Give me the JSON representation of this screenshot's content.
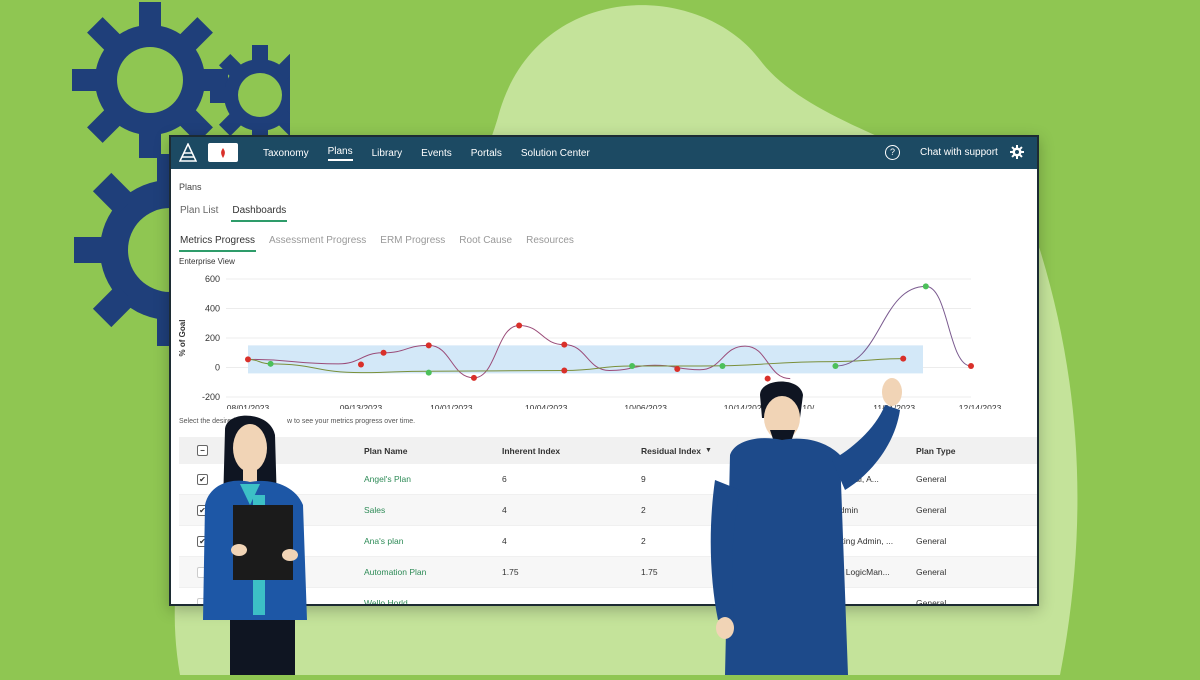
{
  "colors": {
    "background": "#8fc652",
    "topbar": "#1c4a63",
    "accent_green": "#2e9c6a",
    "gear": "#1f3f7a",
    "band": "#cfe6f7"
  },
  "topbar": {
    "nav": [
      {
        "label": "Taxonomy",
        "active": false
      },
      {
        "label": "Plans",
        "active": true
      },
      {
        "label": "Library",
        "active": false
      },
      {
        "label": "Events",
        "active": false
      },
      {
        "label": "Portals",
        "active": false
      },
      {
        "label": "Solution Center",
        "active": false
      }
    ],
    "help_icon": "?",
    "chat_label": "Chat with support",
    "settings_icon": "gear-icon"
  },
  "breadcrumb": "Plans",
  "tabs": [
    {
      "label": "Plan List",
      "active": false
    },
    {
      "label": "Dashboards",
      "active": true
    }
  ],
  "subtabs": [
    {
      "label": "Metrics Progress",
      "active": true
    },
    {
      "label": "Assessment Progress",
      "active": false
    },
    {
      "label": "ERM Progress",
      "active": false
    },
    {
      "label": "Root Cause",
      "active": false
    },
    {
      "label": "Resources",
      "active": false
    }
  ],
  "view_label": "Enterprise View",
  "chart_data": {
    "type": "line",
    "ylabel": "% of Goal",
    "ylim": [
      -200,
      600
    ],
    "yticks": [
      "600",
      "400",
      "200",
      "0",
      "-200"
    ],
    "xtick_labels": [
      "08/01/2023",
      "09/13/2023",
      "10/01/2023",
      "10/04/2023",
      "10/06/2023",
      "10/14/2023",
      "10/",
      "11/01/2023",
      "12/14/2023"
    ],
    "band": [
      -40,
      150
    ],
    "series": [
      {
        "color": "#9a4b78",
        "points": [
          [
            0,
            55
          ],
          [
            2,
            25
          ],
          [
            3,
            100
          ],
          [
            4,
            150
          ],
          [
            5,
            -70
          ],
          [
            6,
            285
          ],
          [
            7,
            155
          ],
          [
            8,
            -20
          ],
          [
            9,
            15
          ],
          [
            10,
            -15
          ],
          [
            11,
            145
          ],
          [
            12,
            -75
          ]
        ]
      },
      {
        "color": "#7a8f3a",
        "points": [
          [
            0,
            55
          ],
          [
            0.5,
            25
          ],
          [
            2.5,
            -35
          ],
          [
            4,
            -25
          ],
          [
            7,
            -20
          ],
          [
            8.5,
            10
          ],
          [
            10,
            10
          ],
          [
            13,
            40
          ],
          [
            14.5,
            60
          ]
        ]
      },
      {
        "color": "#7a5a8f",
        "points": [
          [
            13,
            10
          ],
          [
            15,
            550
          ],
          [
            16,
            10
          ]
        ]
      }
    ],
    "markers": [
      {
        "x": 0,
        "y": 55,
        "color": "#d9302a"
      },
      {
        "x": 0.5,
        "y": 25,
        "color": "#4cc05a"
      },
      {
        "x": 2.5,
        "y": 20,
        "color": "#d9302a"
      },
      {
        "x": 3,
        "y": 100,
        "color": "#d9302a"
      },
      {
        "x": 4,
        "y": 150,
        "color": "#d9302a"
      },
      {
        "x": 4,
        "y": -35,
        "color": "#4cc05a"
      },
      {
        "x": 5,
        "y": -70,
        "color": "#d9302a"
      },
      {
        "x": 6,
        "y": 285,
        "color": "#d9302a"
      },
      {
        "x": 7,
        "y": 155,
        "color": "#d9302a"
      },
      {
        "x": 7,
        "y": -20,
        "color": "#d9302a"
      },
      {
        "x": 8.5,
        "y": 10,
        "color": "#4cc05a"
      },
      {
        "x": 9.5,
        "y": -10,
        "color": "#d9302a"
      },
      {
        "x": 10.5,
        "y": 10,
        "color": "#4cc05a"
      },
      {
        "x": 11.5,
        "y": -75,
        "color": "#d9302a"
      },
      {
        "x": 13,
        "y": 10,
        "color": "#4cc05a"
      },
      {
        "x": 14.5,
        "y": 60,
        "color": "#d9302a"
      },
      {
        "x": 15,
        "y": 550,
        "color": "#4cc05a"
      },
      {
        "x": 16,
        "y": 10,
        "color": "#d9302a"
      }
    ],
    "grid": true,
    "legend": "none"
  },
  "instruction": "Select the desired",
  "instruction_end": "w to see your metrics progress over time.",
  "table": {
    "headers": {
      "plan_name": "Plan Name",
      "inherent": "Inherent Index",
      "residual": "Residual Index",
      "plan_type": "Plan Type"
    },
    "sort_icon": "▼",
    "rows": [
      {
        "checked": true,
        "name": "Angel's Plan",
        "inherent": "6",
        "residual": "9",
        "owners": "...oanal, A...",
        "type": "General"
      },
      {
        "checked": true,
        "name": "Sales",
        "inherent": "4",
        "residual": "2",
        "owners": "Admin",
        "type": "General"
      },
      {
        "checked": true,
        "name": "Ana's plan",
        "inherent": "4",
        "residual": "2",
        "owners": "orting Admin, ...",
        "type": "General"
      },
      {
        "checked": false,
        "name": "Automation Plan",
        "inherent": "1.75",
        "residual": "1.75",
        "owners": "rs, LogicMan...",
        "type": "General"
      },
      {
        "checked": false,
        "name": "Wello Horld",
        "inherent": "",
        "residual": "",
        "owners": "",
        "type": "General"
      }
    ]
  }
}
